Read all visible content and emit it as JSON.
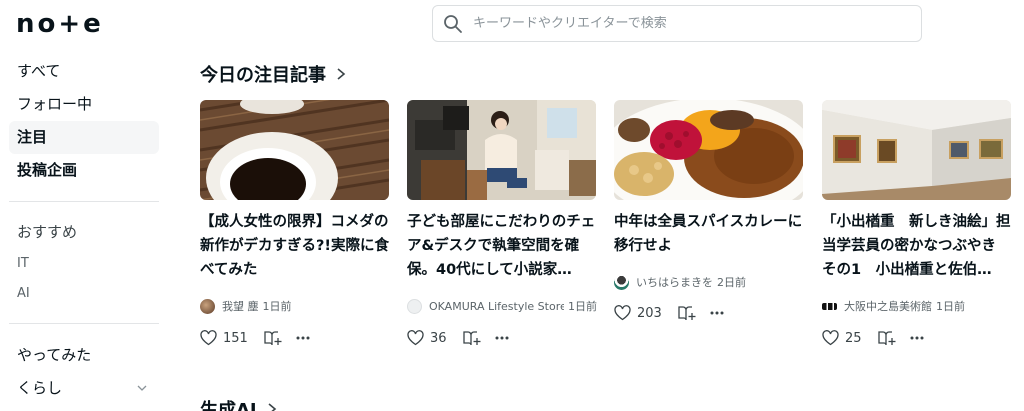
{
  "header": {
    "logo": "no+e",
    "search_placeholder": "キーワードやクリエイターで検索"
  },
  "sidebar": {
    "items": [
      {
        "label": "すべて"
      },
      {
        "label": "フォロー中"
      },
      {
        "label": "注目"
      },
      {
        "label": "投稿企画"
      }
    ],
    "recommend_heading": "おすすめ",
    "recommend_items": [
      {
        "label": "IT"
      },
      {
        "label": "AI"
      }
    ],
    "more_items": [
      {
        "label": "やってみた"
      },
      {
        "label": "くらし"
      }
    ]
  },
  "main": {
    "section_title": "今日の注目記事",
    "next_section_title": "生成AI",
    "cards": [
      {
        "title": "【成人女性の限界】コメダの新作がデカすぎる?!実際に食べてみた",
        "author": "我望 塵",
        "time": "1日前",
        "likes": "151"
      },
      {
        "title": "子ども部屋にこだわりのチェア&デスクで執筆空間を確保。40代にして小説家…",
        "author": "OKAMURA Lifestyle Store",
        "time": "1日前",
        "likes": "36"
      },
      {
        "title": "中年は全員スパイスカレーに移行せよ",
        "author": "いちはらまきを",
        "time": "2日前",
        "likes": "203"
      },
      {
        "title": "「小出楢重　新しき油絵」担当学芸員の密かなつぶやき その1　小出楢重と佐伯…",
        "author": "大阪中之島美術館",
        "time": "1日前",
        "likes": "25"
      }
    ]
  },
  "colors": {
    "text": "#08131a",
    "muted": "#5b6469",
    "border": "#dcdfe1"
  }
}
